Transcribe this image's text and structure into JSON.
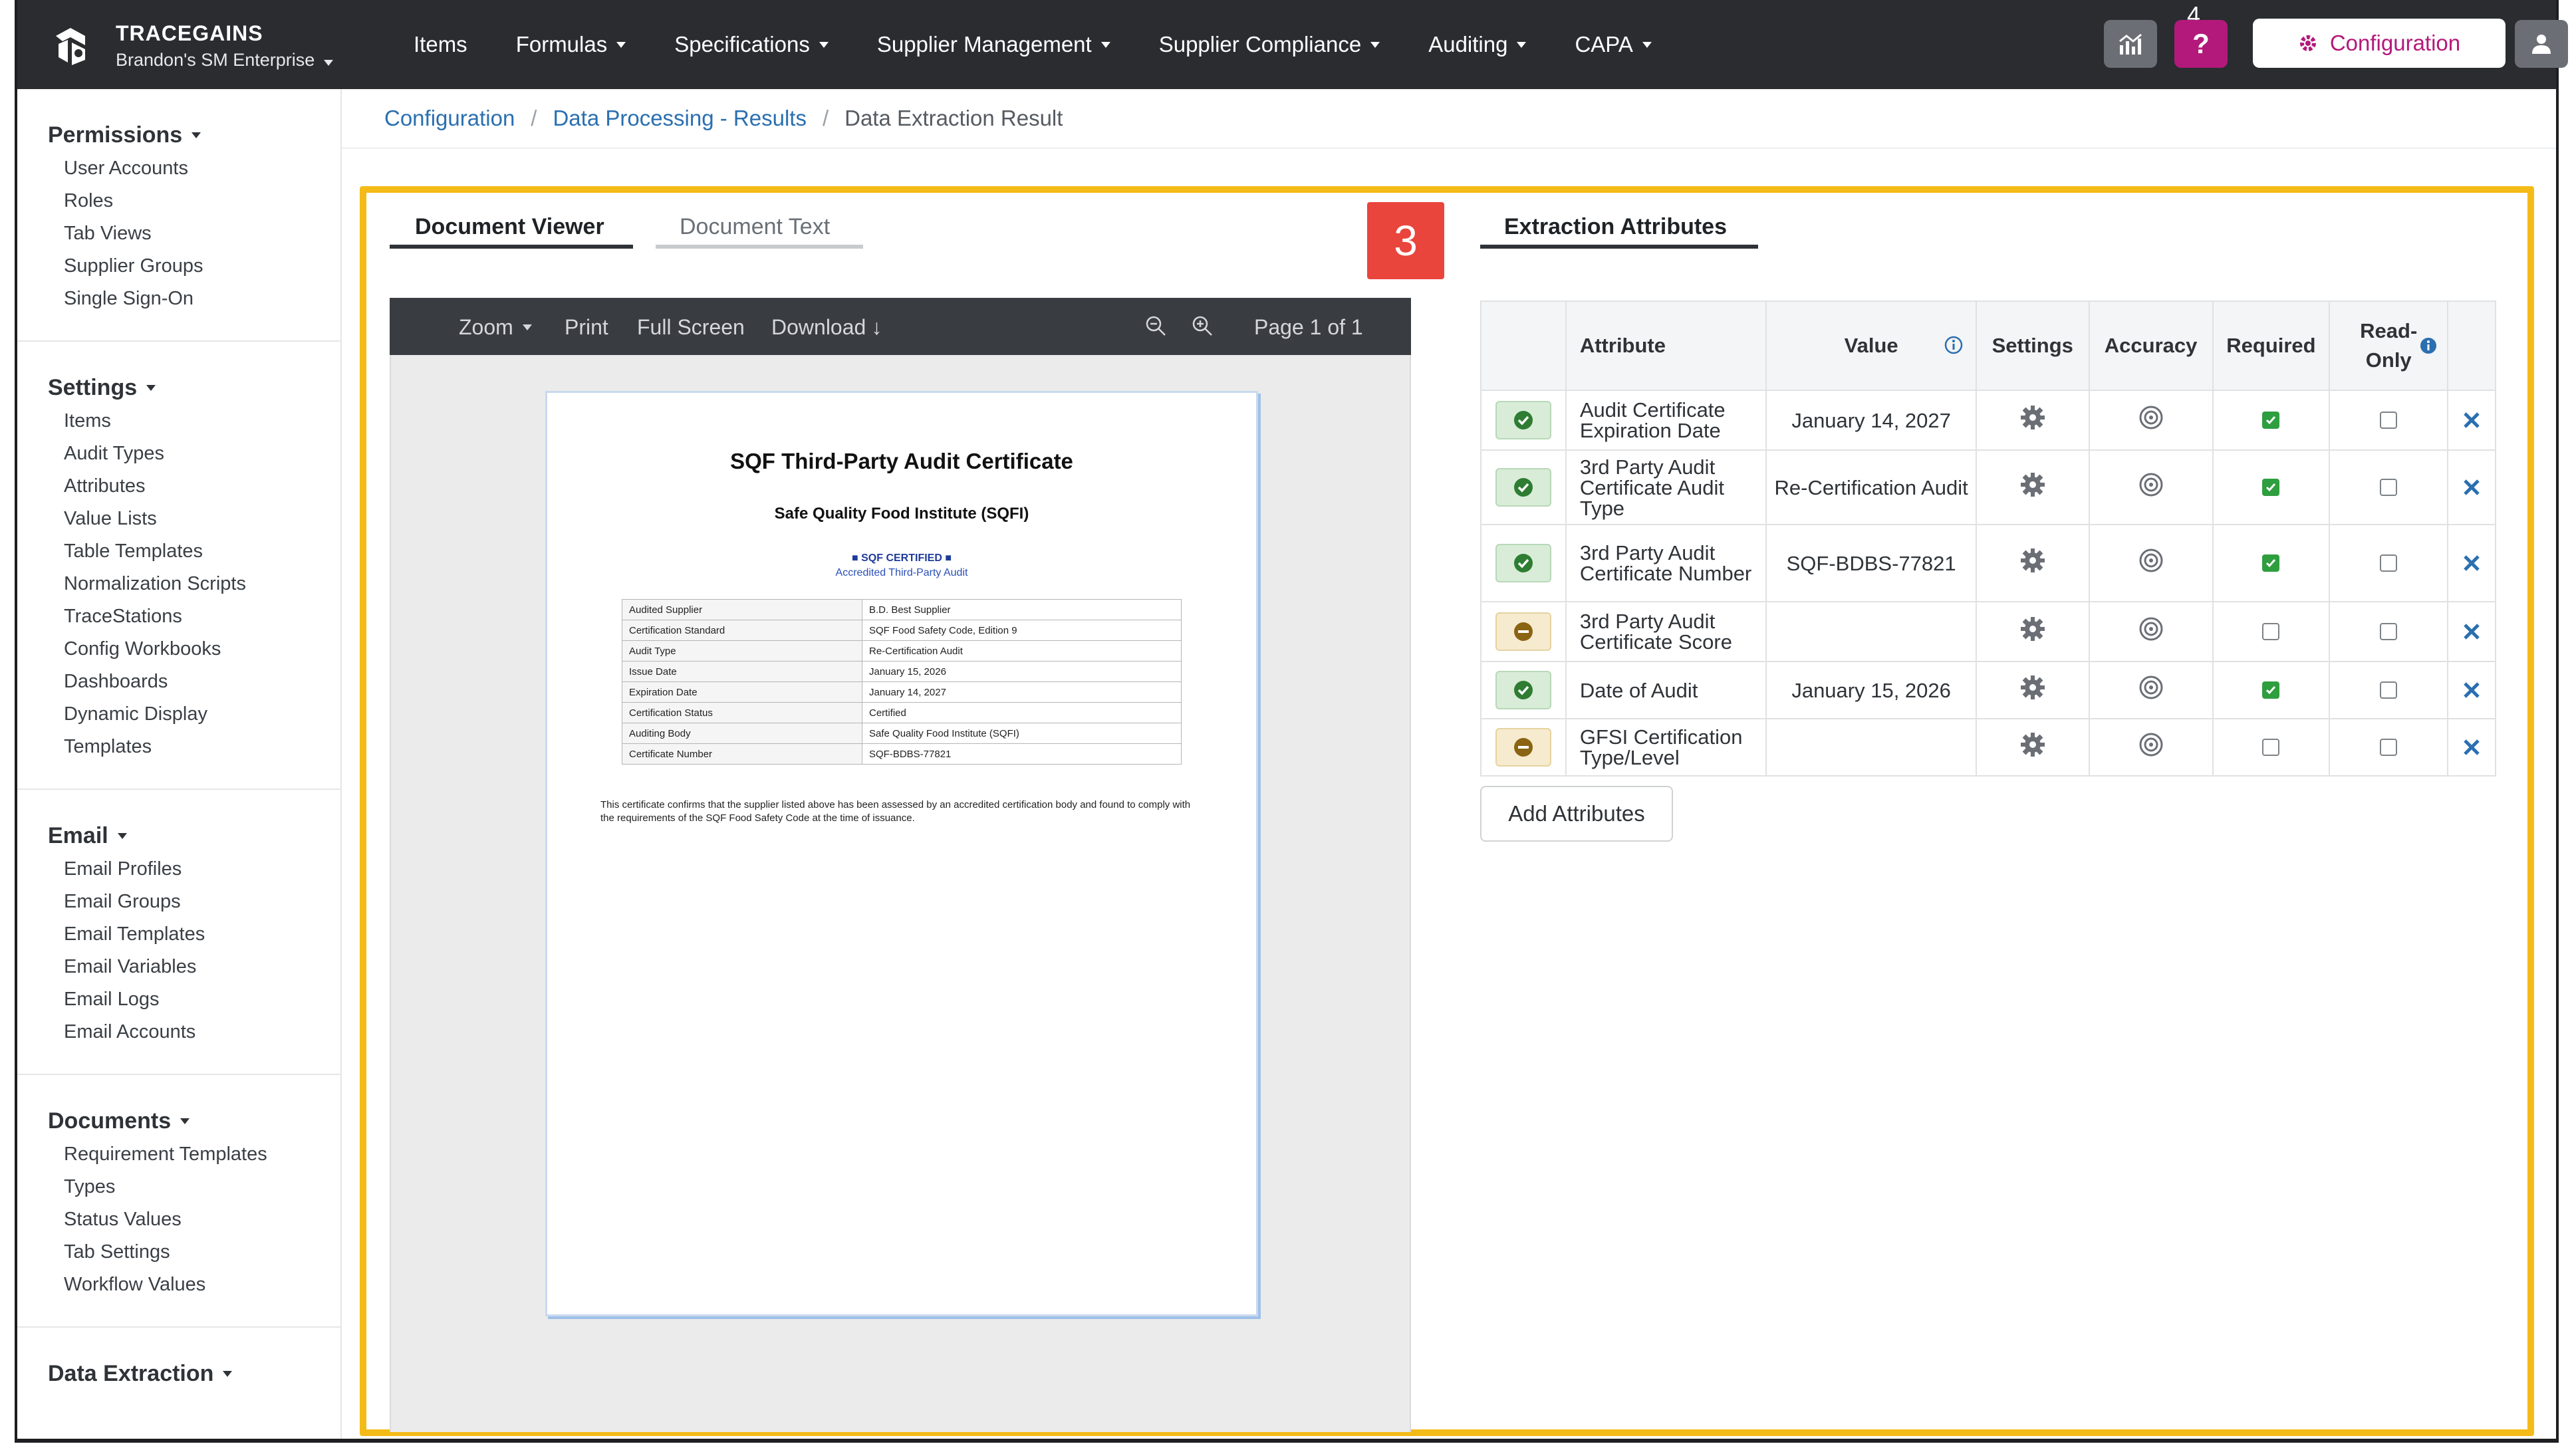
{
  "app": {
    "brand_name": "TRACEGAINS",
    "brand_sub": "Brandon's SM Enterprise"
  },
  "nav": {
    "items": [
      "Items",
      "Formulas",
      "Specifications",
      "Supplier Management",
      "Supplier Compliance",
      "Auditing",
      "CAPA"
    ],
    "help_badge": "4",
    "help_label": "?",
    "config_label": "Configuration"
  },
  "sidebar": {
    "sections": [
      {
        "title": "Permissions",
        "items": [
          "User Accounts",
          "Roles",
          "Tab Views",
          "Supplier Groups",
          "Single Sign-On"
        ]
      },
      {
        "title": "Settings",
        "items": [
          "Items",
          "Audit Types",
          "Attributes",
          "Value Lists",
          "Table Templates",
          "Normalization Scripts",
          "TraceStations",
          "Config Workbooks",
          "Dashboards",
          "Dynamic Display",
          "Templates"
        ]
      },
      {
        "title": "Email",
        "items": [
          "Email Profiles",
          "Email Groups",
          "Email Templates",
          "Email Variables",
          "Email Logs",
          "Email Accounts"
        ]
      },
      {
        "title": "Documents",
        "items": [
          "Requirement Templates",
          "Types",
          "Status Values",
          "Tab Settings",
          "Workflow Values"
        ]
      },
      {
        "title": "Data Extraction",
        "items": []
      }
    ]
  },
  "breadcrumb": {
    "items": [
      "Configuration",
      "Data Processing - Results"
    ],
    "current": "Data Extraction Result"
  },
  "step_marker": "3",
  "tabs": {
    "viewer": "Document Viewer",
    "text": "Document Text",
    "attributes": "Extraction Attributes"
  },
  "viewer": {
    "zoom": "Zoom",
    "print": "Print",
    "fullscreen": "Full Screen",
    "download": "Download",
    "page": "Page 1 of 1"
  },
  "document": {
    "title": "SQF Third-Party Audit Certificate",
    "subtitle": "Safe Quality Food Institute (SQFI)",
    "cert_mark": "■ SQF CERTIFIED ■",
    "accredited": "Accredited Third-Party Audit",
    "rows": [
      [
        "Audited Supplier",
        "B.D. Best Supplier"
      ],
      [
        "Certification Standard",
        "SQF Food Safety Code, Edition 9"
      ],
      [
        "Audit Type",
        "Re-Certification Audit"
      ],
      [
        "Issue Date",
        "January 15, 2026"
      ],
      [
        "Expiration Date",
        "January 14, 2027"
      ],
      [
        "Certification Status",
        "Certified"
      ],
      [
        "Auditing Body",
        "Safe Quality Food Institute (SQFI)"
      ],
      [
        "Certificate Number",
        "SQF-BDBS-77821"
      ]
    ],
    "paragraph": "This certificate confirms that the supplier listed above has been assessed by an accredited certification body and found to comply with the requirements of the SQF Food Safety Code at the time of issuance."
  },
  "attributes": {
    "headers": {
      "attribute": "Attribute",
      "value": "Value",
      "settings": "Settings",
      "accuracy": "Accuracy",
      "required": "Required",
      "readonly": "Read-Only"
    },
    "rows": [
      {
        "status": "ok",
        "name": "Audit Certificate Expiration Date",
        "value": "January 14, 2027",
        "required": true,
        "readonly": false
      },
      {
        "status": "ok",
        "name": "3rd Party Audit Certificate Audit Type",
        "value": "Re-Certification Audit",
        "required": true,
        "readonly": false
      },
      {
        "status": "ok",
        "name": "3rd Party Audit Certificate Number",
        "value": "SQF-BDBS-77821",
        "required": true,
        "readonly": false
      },
      {
        "status": "warn",
        "name": "3rd Party Audit Certificate Score",
        "value": "",
        "required": false,
        "readonly": false
      },
      {
        "status": "ok",
        "name": "Date of Audit",
        "value": "January 15, 2026",
        "required": true,
        "readonly": false
      },
      {
        "status": "warn",
        "name": "GFSI Certification Type/Level",
        "value": "",
        "required": false,
        "readonly": false
      }
    ],
    "add_label": "Add Attributes"
  },
  "colors": {
    "brand_magenta": "#b3197b",
    "highlight": "#f4bb18",
    "link": "#2a6fb0",
    "ok": "#2e9e3f",
    "warn": "#a07a1a"
  }
}
